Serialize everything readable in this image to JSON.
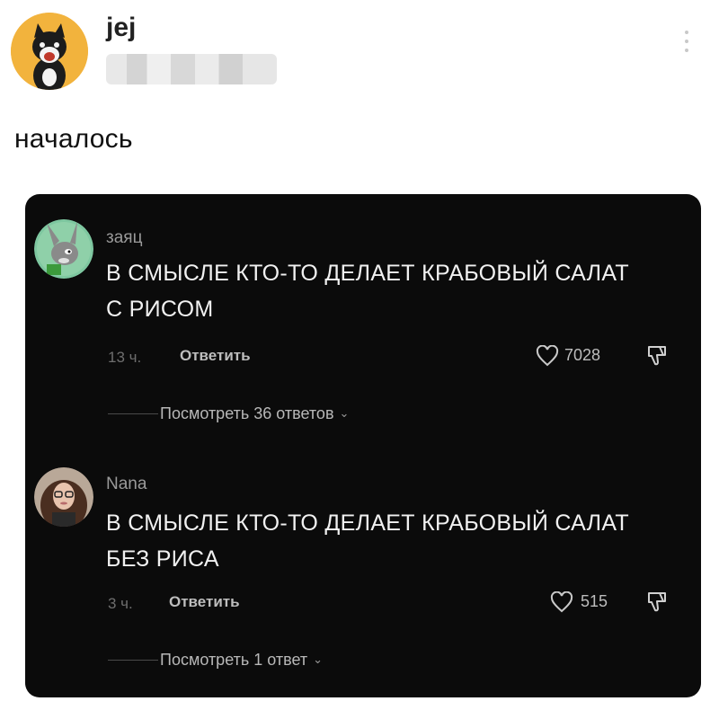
{
  "post": {
    "author": "jej",
    "text": "началось"
  },
  "comments": [
    {
      "author": "заяц",
      "text_line1": "В СМЫСЛЕ КТО-ТО ДЕЛАЕТ КРАБОВЫЙ САЛАТ",
      "text_line2": "С РИСОМ",
      "time": "13 ч.",
      "reply_label": "Ответить",
      "likes": "7028",
      "view_replies": "Посмотреть 36 ответов"
    },
    {
      "author": "Nana",
      "text_line1": "В СМЫСЛЕ КТО-ТО ДЕЛАЕТ КРАБОВЫЙ САЛАТ",
      "text_line2": "БЕЗ РИСА",
      "time": "3 ч.",
      "reply_label": "Ответить",
      "likes": "515",
      "view_replies": "Посмотреть 1 ответ"
    }
  ],
  "icons": {
    "more": "more-vertical-icon",
    "like": "heart-icon",
    "dislike": "thumbs-down-icon",
    "expand": "chevron-down-icon"
  }
}
